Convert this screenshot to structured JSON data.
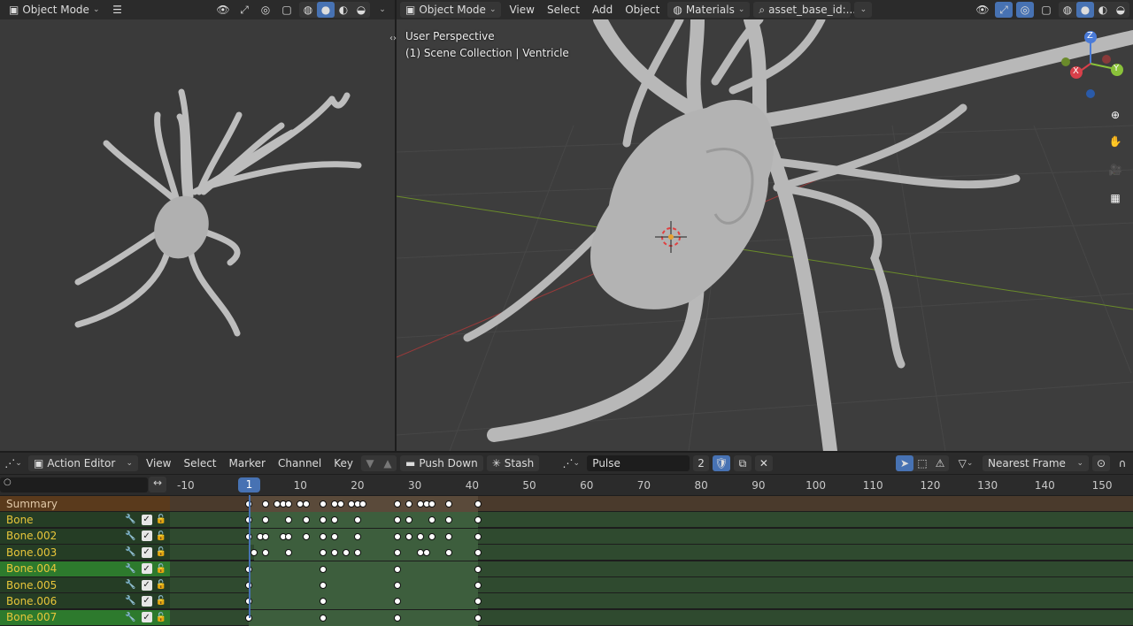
{
  "left_header": {
    "mode_label": "Object Mode"
  },
  "right_header": {
    "mode_label": "Object Mode",
    "menus": [
      "View",
      "Select",
      "Add",
      "Object"
    ],
    "materials_label": "Materials",
    "search_value": "asset_base_id:..."
  },
  "viewport": {
    "perspective": "User Perspective",
    "collection": "(1) Scene Collection | Ventricle"
  },
  "gizmo": {
    "z": "Z",
    "y": "Y",
    "x": "X"
  },
  "action_editor": {
    "editor_label": "Action Editor",
    "menus": [
      "View",
      "Select",
      "Marker",
      "Channel",
      "Key"
    ],
    "push_down": "Push Down",
    "stash": "Stash",
    "action_name": "Pulse",
    "users": "2",
    "snap_label": "Nearest Frame",
    "current_frame": "1",
    "ticks": [
      "-10",
      "10",
      "20",
      "30",
      "40",
      "50",
      "60",
      "70",
      "80",
      "90",
      "100",
      "110",
      "120",
      "130",
      "140",
      "150"
    ],
    "channels": [
      {
        "name": "Summary"
      },
      {
        "name": "Bone"
      },
      {
        "name": "Bone.002"
      },
      {
        "name": "Bone.003"
      },
      {
        "name": "Bone.004"
      },
      {
        "name": "Bone.005"
      },
      {
        "name": "Bone.006"
      },
      {
        "name": "Bone.007"
      }
    ]
  },
  "colors": {
    "accent": "#4772b3",
    "summary_bg": "#5a3a1c",
    "bone_text": "#e8c63a",
    "channel_bg": "#2a4a2a",
    "channel_selected_bg": "#2d7a2d"
  }
}
